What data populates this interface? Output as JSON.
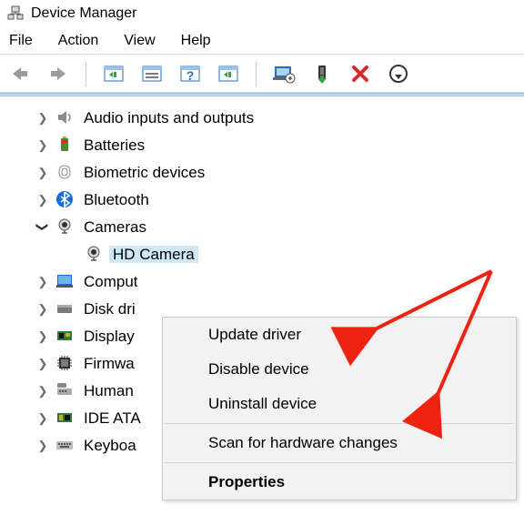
{
  "window": {
    "title": "Device Manager"
  },
  "menubar": {
    "file": "File",
    "action": "Action",
    "view": "View",
    "help": "Help"
  },
  "tree": {
    "items": [
      {
        "label": "Audio inputs and outputs",
        "expanded": false
      },
      {
        "label": "Batteries",
        "expanded": false
      },
      {
        "label": "Biometric devices",
        "expanded": false
      },
      {
        "label": "Bluetooth",
        "expanded": false
      },
      {
        "label": "Cameras",
        "expanded": true,
        "children": [
          {
            "label": "HD Camera",
            "selected": true
          }
        ]
      },
      {
        "label": "Computers",
        "expanded": false,
        "truncated": "Comput"
      },
      {
        "label": "Disk drives",
        "expanded": false,
        "truncated": "Disk dri"
      },
      {
        "label": "Display adapters",
        "expanded": false,
        "truncated": "Display"
      },
      {
        "label": "Firmware",
        "expanded": false,
        "truncated": "Firmwa"
      },
      {
        "label": "Human Interface Devices",
        "expanded": false,
        "truncated": "Human"
      },
      {
        "label": "IDE ATA/ATAPI controllers",
        "expanded": false,
        "truncated": "IDE ATA"
      },
      {
        "label": "Keyboards",
        "expanded": false,
        "truncated": "Keyboa"
      }
    ]
  },
  "context_menu": {
    "update": "Update driver",
    "disable": "Disable device",
    "uninstall": "Uninstall device",
    "scan": "Scan for hardware changes",
    "properties": "Properties"
  }
}
